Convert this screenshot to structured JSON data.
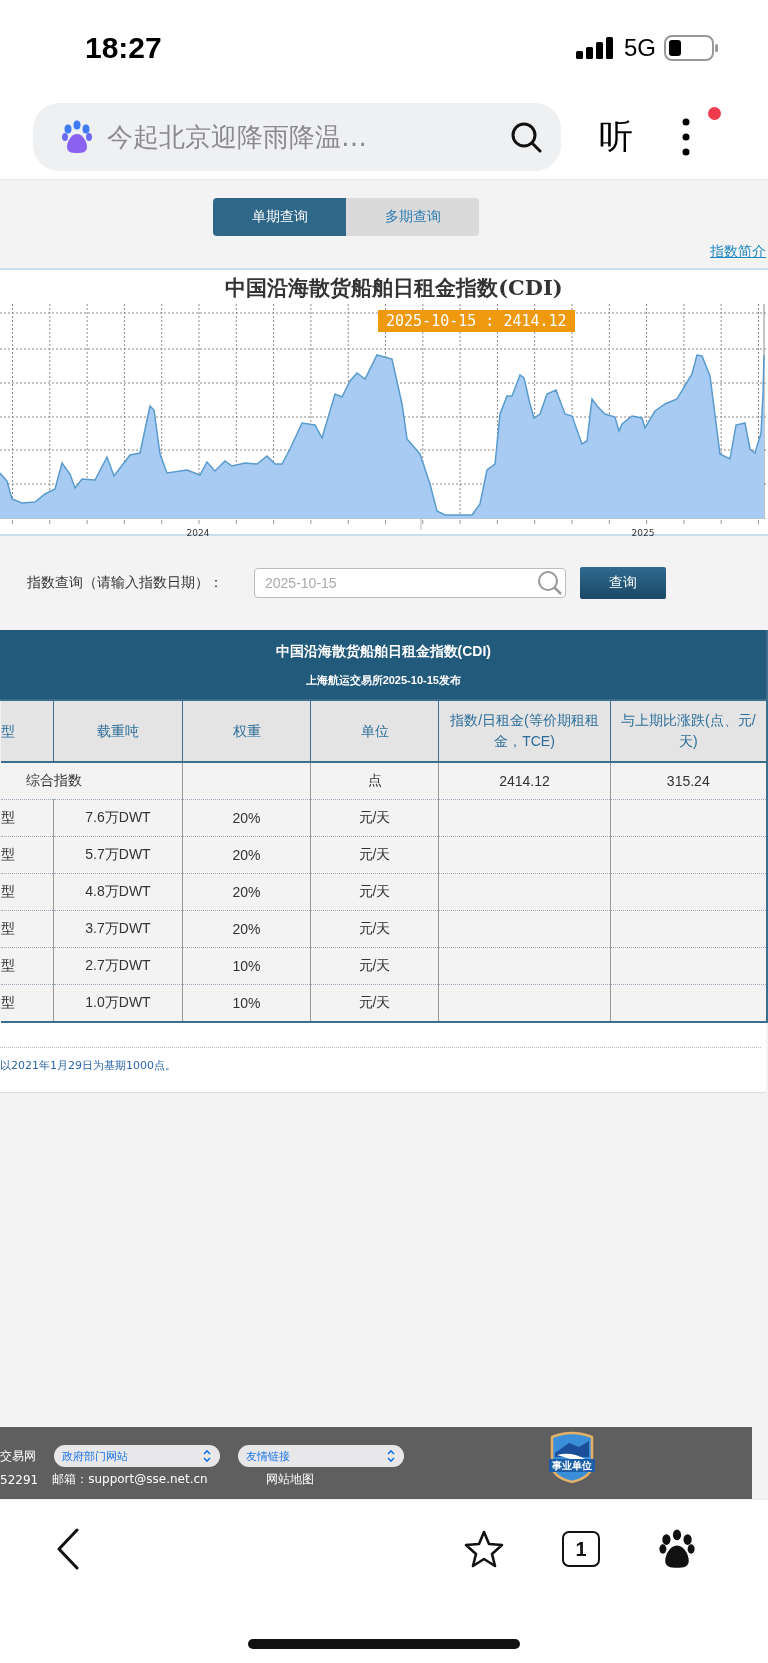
{
  "status_bar": {
    "time": "18:27",
    "network": "5G"
  },
  "browser": {
    "search_placeholder": "今起北京迎降雨降温…",
    "listen_label": "听",
    "has_notice": true
  },
  "tabs": [
    {
      "label": "单期查询",
      "selected": true
    },
    {
      "label": "多期查询",
      "selected": false
    }
  ],
  "intro_link": "指数简介",
  "chart": {
    "title": "中国沿海散货船舶日租金指数(CDI)",
    "tooltip": "2025-10-15 : 2414.12",
    "x_labels": [
      "2024",
      "2025"
    ]
  },
  "query": {
    "label": "指数查询（请输入指数日期）：",
    "placeholder": "2025-10-15",
    "button": "查询"
  },
  "table": {
    "title": "中国沿海散货船舶日租金指数(CDI)",
    "subtitle": "上海航运交易所2025-10-15发布",
    "columns": [
      "型",
      "载重吨",
      "权重",
      "单位",
      "指数/日租金(等价期租租金，TCE)",
      "与上期比涨跌(点、元/天)"
    ],
    "rows": [
      {
        "kind": "total",
        "name": "综合指数",
        "unit": "点",
        "index": "2414.12",
        "change": "315.24"
      },
      {
        "kind": "ship",
        "type": "型",
        "dwt": "7.6万DWT",
        "weight": "20%",
        "unit": "元/天"
      },
      {
        "kind": "ship",
        "type": "型",
        "dwt": "5.7万DWT",
        "weight": "20%",
        "unit": "元/天"
      },
      {
        "kind": "ship",
        "type": "型",
        "dwt": "4.8万DWT",
        "weight": "20%",
        "unit": "元/天"
      },
      {
        "kind": "ship",
        "type": "型",
        "dwt": "3.7万DWT",
        "weight": "20%",
        "unit": "元/天"
      },
      {
        "kind": "ship",
        "type": "型",
        "dwt": "2.7万DWT",
        "weight": "10%",
        "unit": "元/天"
      },
      {
        "kind": "ship",
        "type": "型",
        "dwt": "1.0万DWT",
        "weight": "10%",
        "unit": "元/天"
      }
    ]
  },
  "note": "以2021年1月29日为基期1000点。",
  "footer": {
    "site": "交易网",
    "selects": [
      "政府部门网站",
      "友情链接"
    ],
    "phone": "52291",
    "email": "邮箱：support@sse.net.cn",
    "sitemap": "网站地图",
    "badge": "事业单位"
  },
  "bottom_bar": {
    "tab_count": "1"
  }
}
